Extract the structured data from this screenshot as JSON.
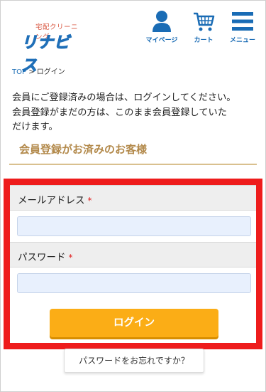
{
  "header": {
    "logo_subtitle": "宅配クリーニング",
    "logo_text": "リナビス",
    "nav": [
      {
        "label": "マイページ",
        "icon": "user-icon"
      },
      {
        "label": "カート",
        "icon": "cart-icon"
      },
      {
        "label": "メニュー",
        "icon": "menu-icon"
      }
    ]
  },
  "breadcrumb": {
    "home": "TOP",
    "separator": ">",
    "current": "ログイン"
  },
  "intro": {
    "line1": "会員にご登録済みの場合は、ログインしてください。",
    "line2": "会員登録がまだの方は、このまま会員登録していた",
    "line3": "だけます。"
  },
  "section_title": "会員登録がお済みのお客様",
  "form": {
    "email_label": "メールアドレス",
    "email_value": "",
    "password_label": "パスワード",
    "password_value": "",
    "required_mark": "*",
    "login_button": "ログイン"
  },
  "forgot_password": "パスワードをお忘れですか？",
  "colors": {
    "brand_blue": "#1a6cb5",
    "section_gold": "#b38a4c",
    "button_orange": "#fbad16",
    "highlight_red": "#ee1c1c",
    "input_bg": "#e8f0fd"
  }
}
